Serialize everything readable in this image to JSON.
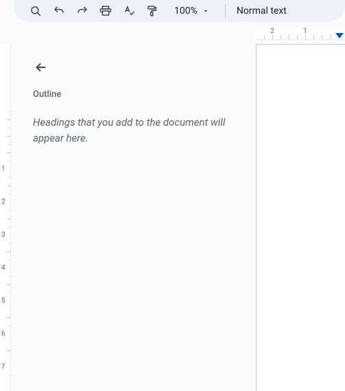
{
  "toolbar": {
    "zoom_level": "100%",
    "style_label": "Normal text"
  },
  "ruler": {
    "h_labels": [
      "2",
      "1"
    ],
    "v_labels": [
      "1",
      "2",
      "3",
      "4",
      "5",
      "6",
      "7"
    ]
  },
  "outline": {
    "title": "Outline",
    "hint": "Headings that you add to the document will appear here."
  }
}
